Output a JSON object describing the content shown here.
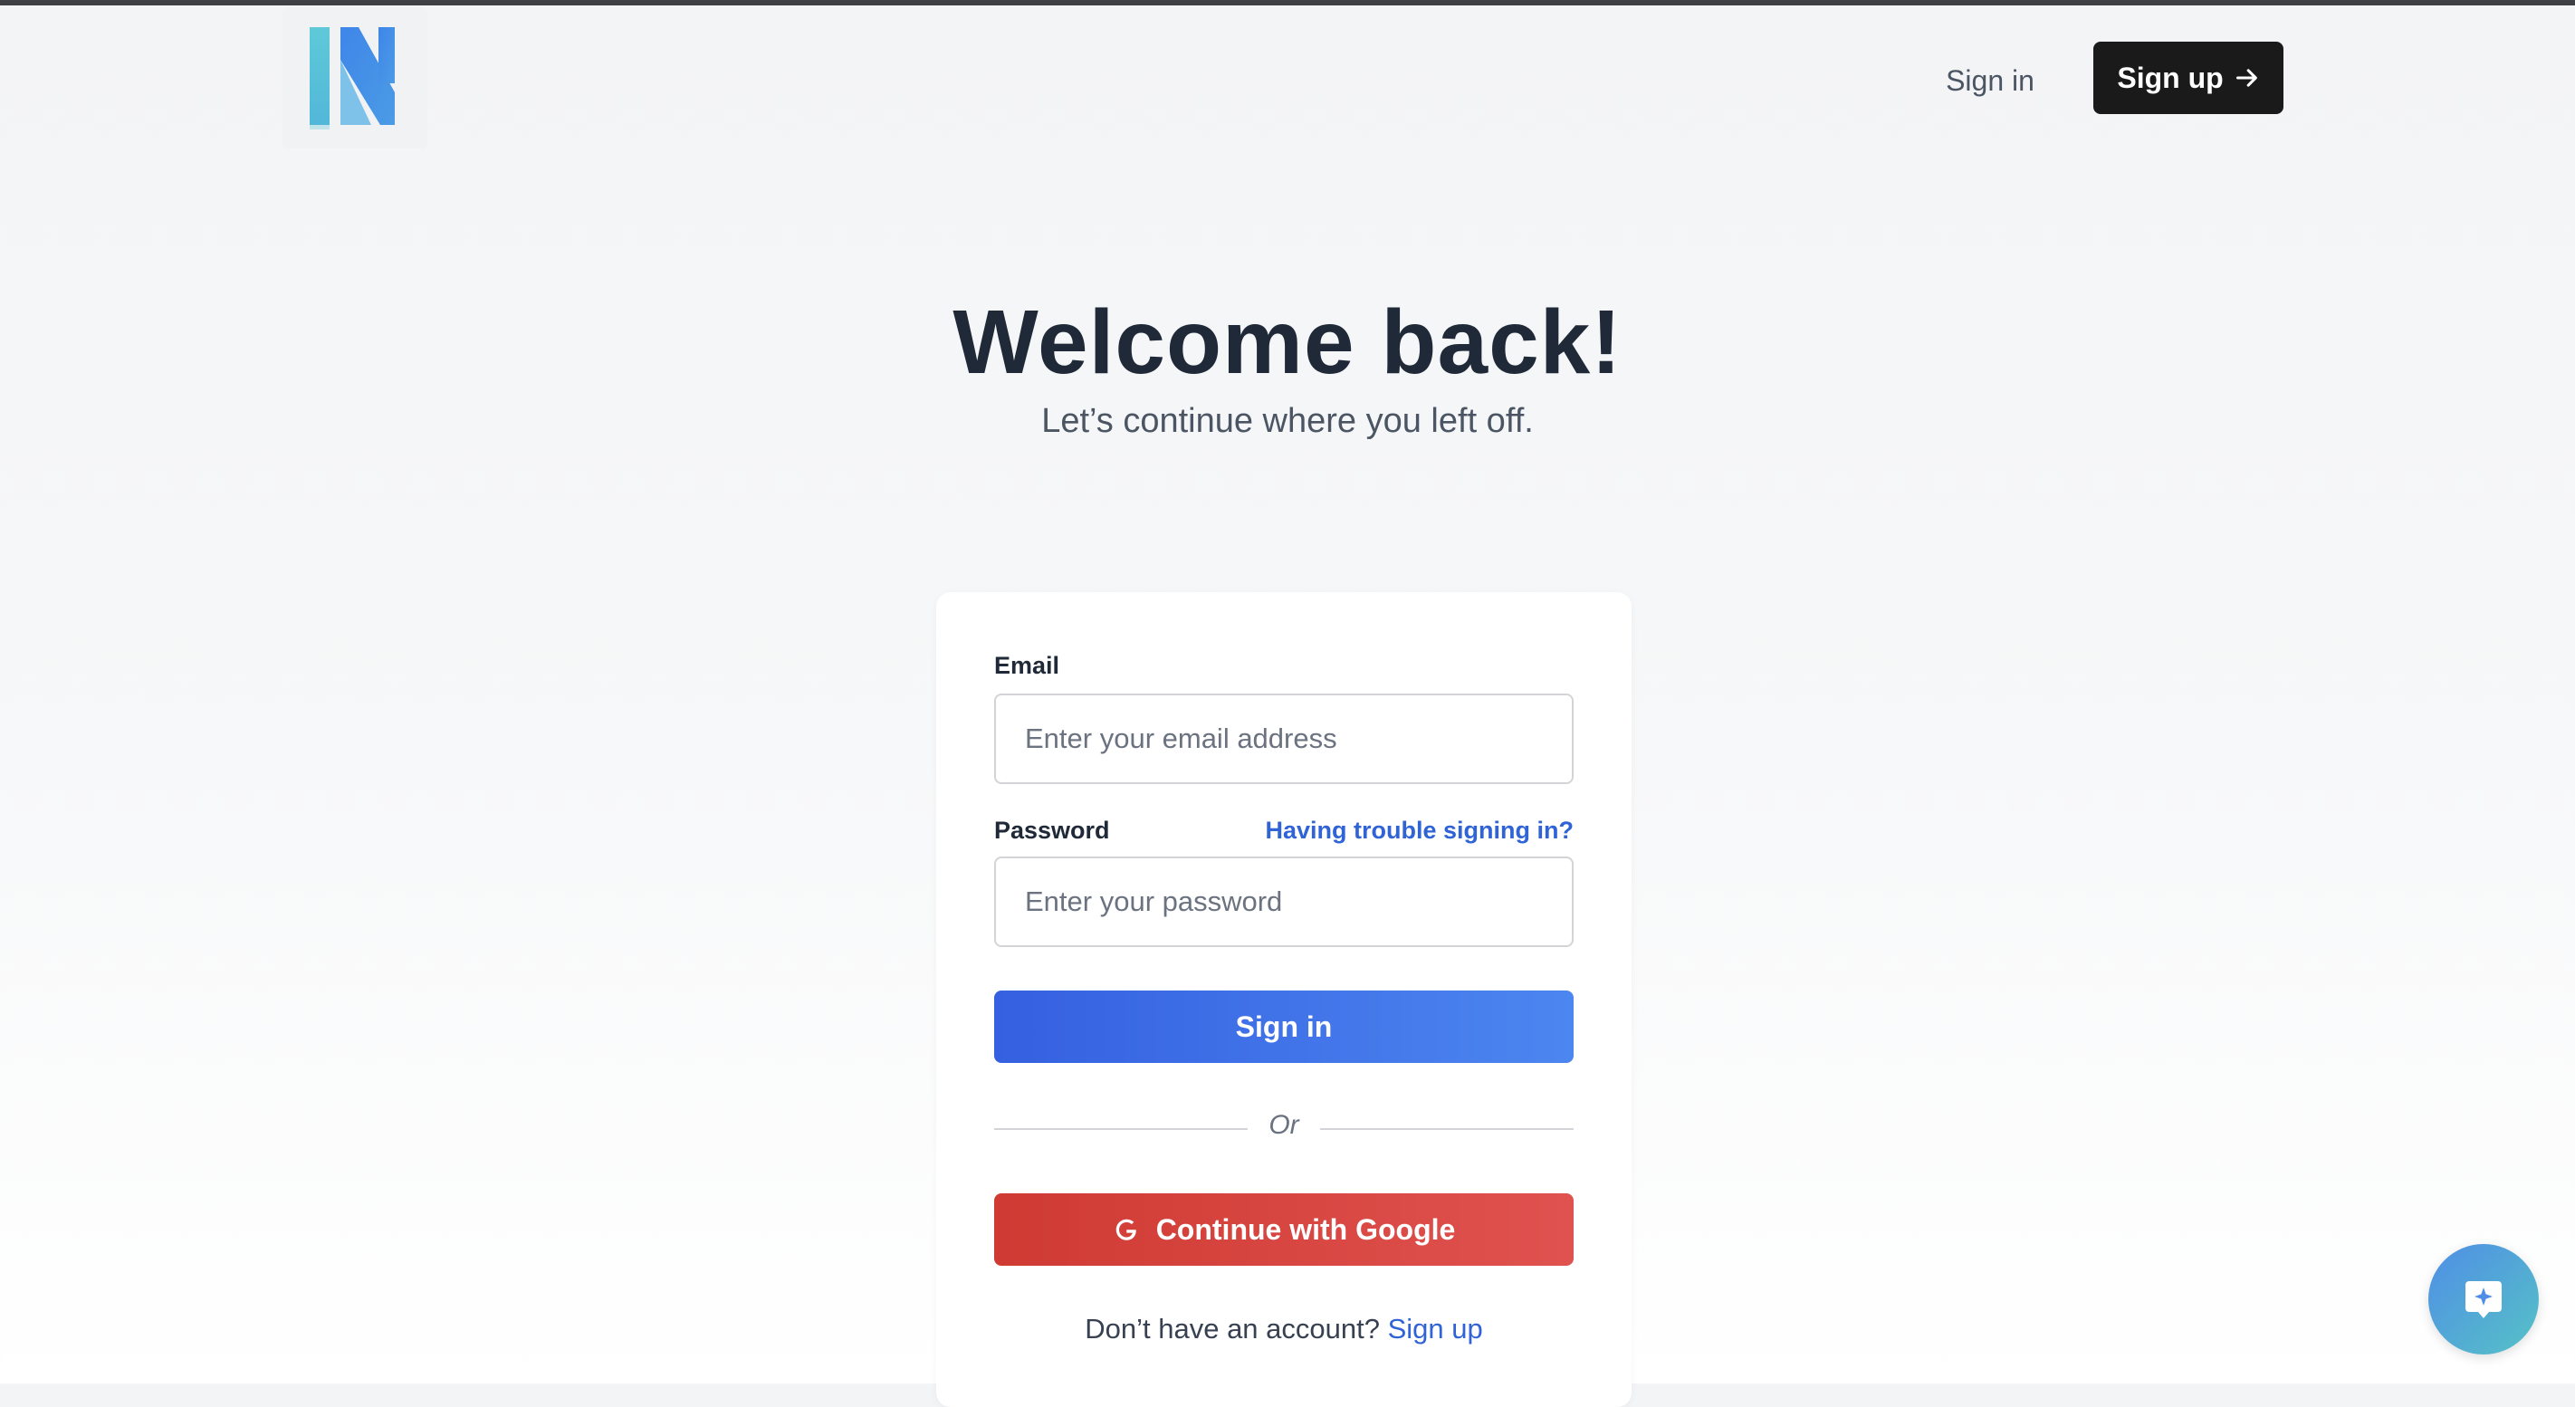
{
  "header": {
    "logo_icon": "k-logo-icon",
    "signin_label": "Sign in",
    "signup_label": "Sign up",
    "signup_icon": "arrow-right-icon"
  },
  "hero": {
    "title": "Welcome back!",
    "subtitle": "Let’s continue where you left off."
  },
  "form": {
    "email_label": "Email",
    "email_placeholder": "Enter your email address",
    "email_value": "",
    "password_label": "Password",
    "password_placeholder": "Enter your password",
    "password_value": "",
    "trouble_link": "Having trouble signing in?",
    "signin_button": "Sign in",
    "divider_text": "Or",
    "google_button": "Continue with Google",
    "google_icon": "google-icon",
    "footer_prompt": "Don’t have an account?",
    "footer_link": "Sign up"
  },
  "help_widget": {
    "icon": "help-chat-icon"
  },
  "colors": {
    "primary_blue": "#3560e0",
    "google_red": "#cf3a33",
    "dark_button": "#1a1a1a",
    "link_blue": "#2f63d6"
  }
}
